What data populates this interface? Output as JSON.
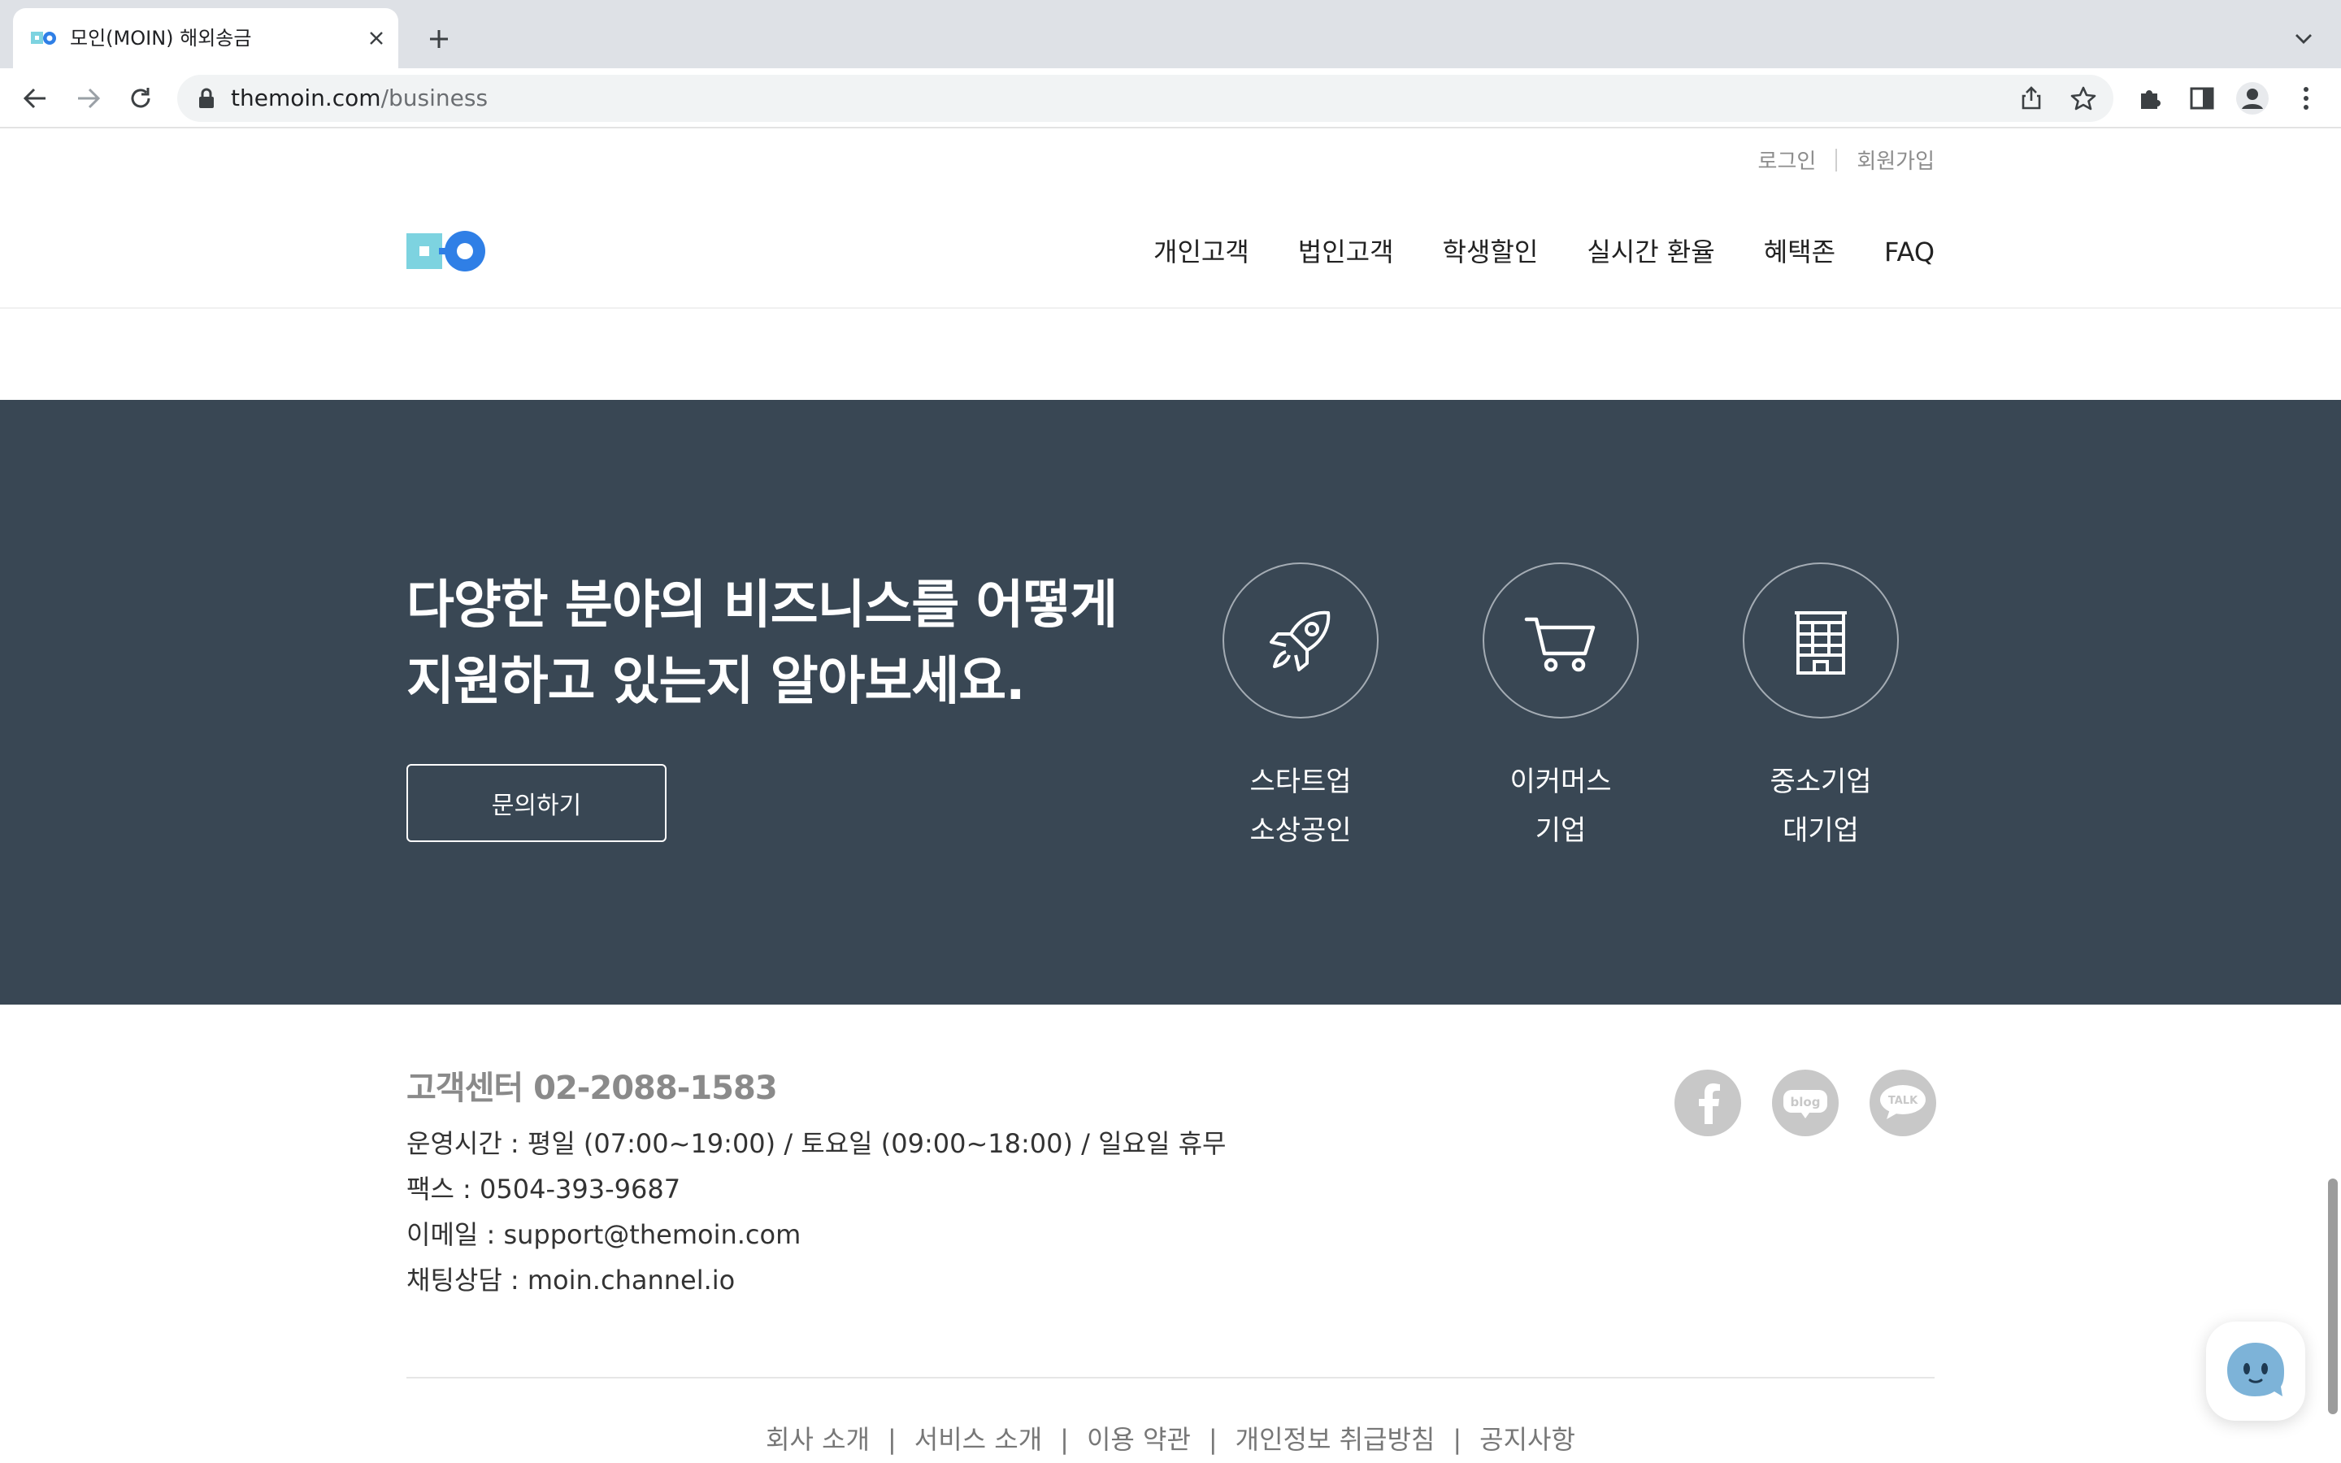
{
  "browser": {
    "tab_title": "모인(MOIN) 해외송금",
    "url_host": "themoin.com",
    "url_path": "/business"
  },
  "header": {
    "login": "로그인",
    "signup": "회원가입",
    "nav": [
      "개인고객",
      "법인고객",
      "학생할인",
      "실시간 환율",
      "혜택존",
      "FAQ"
    ]
  },
  "business": {
    "title_line1": "다양한 분야의 비즈니스를 어떻게",
    "title_line2": "지원하고 있는지 알아보세요.",
    "inquiry_label": "문의하기",
    "categories": [
      {
        "icon": "rocket-icon",
        "line1": "스타트업",
        "line2": "소상공인"
      },
      {
        "icon": "shopping-cart-icon",
        "line1": "이커머스",
        "line2": "기업"
      },
      {
        "icon": "building-icon",
        "line1": "중소기업",
        "line2": "대기업"
      }
    ]
  },
  "footer": {
    "cs_title": "고객센터 02-2088-1583",
    "hours": "운영시간 : 평일 (07:00~19:00) / 토요일 (09:00~18:00) / 일요일 휴무",
    "fax": "팩스 : 0504-393-9687",
    "email": "이메일 : support@themoin.com",
    "chat": "채팅상담 : moin.channel.io",
    "social": [
      "facebook-icon",
      "blog-icon",
      "kakao-talk-icon"
    ],
    "blog_text": "blog",
    "talk_text": "TALK",
    "links": [
      "회사 소개",
      "서비스 소개",
      "이용 약관",
      "개인정보 취급방침",
      "공지사항"
    ]
  },
  "colors": {
    "dark_section": "#394754",
    "brand_cyan": "#7dd3e0",
    "brand_blue": "#2f7fe6"
  }
}
